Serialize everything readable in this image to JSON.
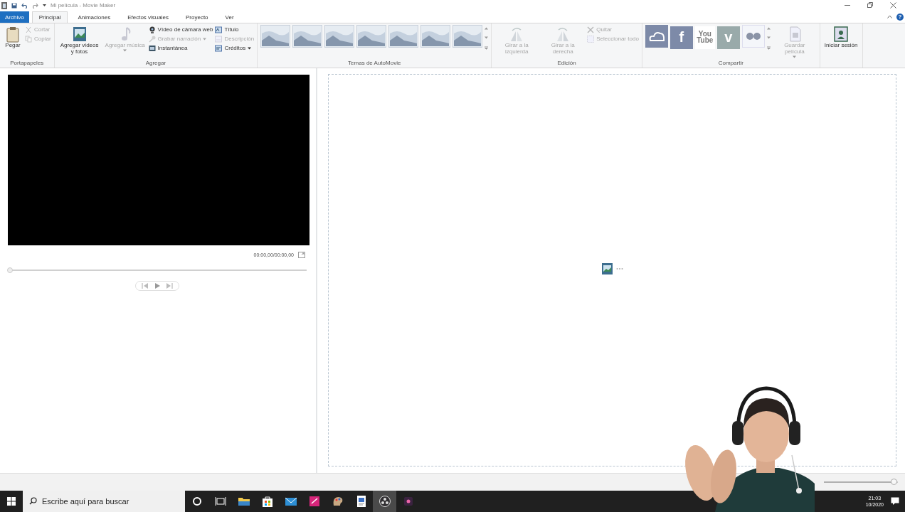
{
  "window": {
    "title": "Mi película - Movie Maker",
    "help_label": "?"
  },
  "tabs": [
    {
      "label": "Archivo",
      "kind": "file",
      "selected": false
    },
    {
      "label": "Principal",
      "kind": "tab",
      "selected": true
    },
    {
      "label": "Animaciones",
      "kind": "tab",
      "selected": false
    },
    {
      "label": "Efectos visuales",
      "kind": "tab",
      "selected": false
    },
    {
      "label": "Proyecto",
      "kind": "tab",
      "selected": false
    },
    {
      "label": "Ver",
      "kind": "tab",
      "selected": false
    }
  ],
  "ribbon": {
    "groups": [
      {
        "label": "Portapapeles",
        "items": [
          {
            "kind": "large",
            "label": "Pegar",
            "disabled": false,
            "dropdown": false
          },
          {
            "kind": "small",
            "label": "Cortar",
            "disabled": true,
            "dropdown": false
          },
          {
            "kind": "small",
            "label": "Copiar",
            "disabled": true,
            "dropdown": false
          }
        ]
      },
      {
        "label": "Agregar",
        "items": [
          {
            "kind": "large",
            "label": "Agregar videos y fotos",
            "disabled": false,
            "dropdown": false
          },
          {
            "kind": "large",
            "label": "Agregar música",
            "disabled": true,
            "dropdown": true
          },
          {
            "kind": "small",
            "label": "Vídeo de cámara web",
            "disabled": false,
            "dropdown": false
          },
          {
            "kind": "small",
            "label": "Grabar narración",
            "disabled": true,
            "dropdown": true
          },
          {
            "kind": "small",
            "label": "Instantánea",
            "disabled": false,
            "dropdown": false
          },
          {
            "kind": "small",
            "label": "Título",
            "disabled": false,
            "dropdown": false
          },
          {
            "kind": "small",
            "label": "Descripción",
            "disabled": true,
            "dropdown": false
          },
          {
            "kind": "small",
            "label": "Créditos",
            "disabled": false,
            "dropdown": true
          }
        ]
      },
      {
        "label": "Temas de AutoMovie",
        "items": [
          {
            "kind": "theme"
          },
          {
            "kind": "theme"
          },
          {
            "kind": "theme"
          },
          {
            "kind": "theme"
          },
          {
            "kind": "theme"
          },
          {
            "kind": "theme"
          },
          {
            "kind": "theme"
          }
        ]
      },
      {
        "label": "Edición",
        "items": [
          {
            "kind": "large",
            "label": "Girar a la izquierda",
            "disabled": true,
            "dropdown": false
          },
          {
            "kind": "large",
            "label": "Girar a la derecha",
            "disabled": true,
            "dropdown": false
          },
          {
            "kind": "small",
            "label": "Quitar",
            "disabled": true,
            "dropdown": false
          },
          {
            "kind": "small",
            "label": "Seleccionar todo",
            "disabled": true,
            "dropdown": false
          }
        ]
      },
      {
        "label": "Compartir",
        "items": [
          {
            "kind": "cloud-tile"
          },
          {
            "kind": "text-tile",
            "label": "f"
          },
          {
            "kind": "text-tile",
            "label": "You Tube"
          },
          {
            "kind": "text-tile",
            "label": "v"
          },
          {
            "kind": "dots-tile"
          },
          {
            "kind": "large",
            "label": "Guardar película",
            "disabled": true,
            "dropdown": true
          }
        ]
      },
      {
        "items": [
          {
            "kind": "large",
            "label": "Iniciar sesión",
            "disabled": false,
            "dropdown": false
          }
        ]
      }
    ]
  },
  "preview": {
    "timecode": "00:00,00/00:00,00",
    "seek": {
      "level": 0
    }
  },
  "status_bar": {
    "zoom": {
      "level": 0.95
    }
  },
  "taskbar": {
    "search": {
      "placeholder": "Escribe aquí para buscar"
    },
    "apps": [
      {
        "kind": "cortana",
        "selected": false
      },
      {
        "kind": "taskview",
        "selected": false
      },
      {
        "kind": "folder",
        "selected": false
      },
      {
        "kind": "store",
        "selected": false
      },
      {
        "kind": "mail",
        "selected": false
      },
      {
        "kind": "pink",
        "selected": false
      },
      {
        "kind": "paint",
        "selected": false
      },
      {
        "kind": "doc",
        "selected": false
      },
      {
        "kind": "obs",
        "selected": true
      },
      {
        "kind": "dark",
        "selected": false
      }
    ],
    "time": "21:03",
    "date": "10/2020"
  }
}
